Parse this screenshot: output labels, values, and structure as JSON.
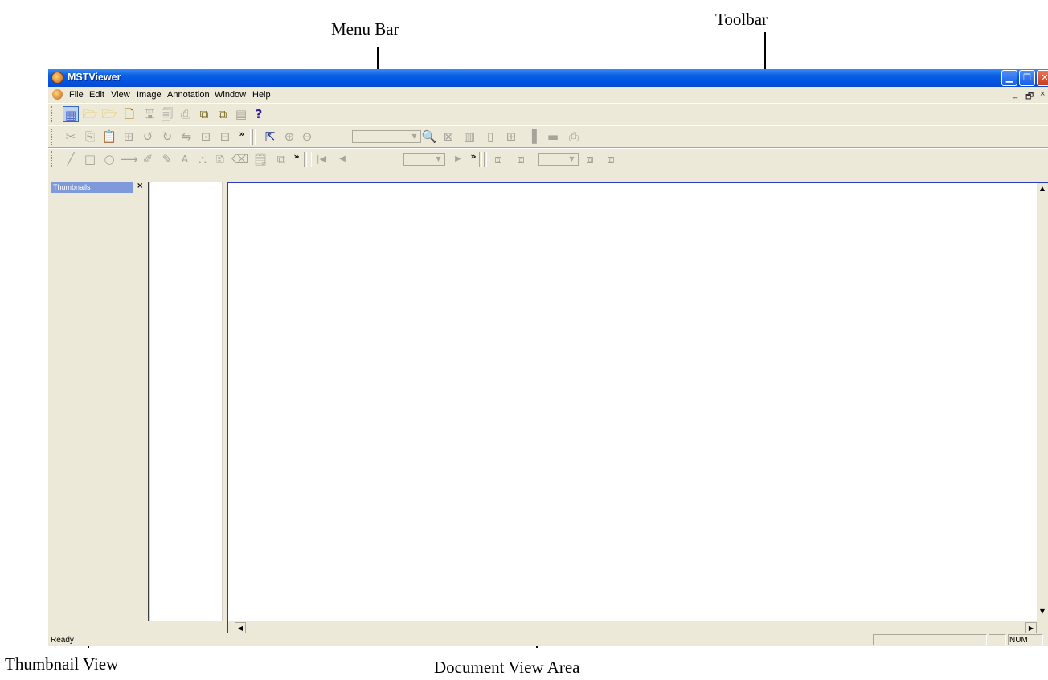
{
  "callouts": {
    "menu_bar": "Menu Bar",
    "toolbar": "Toolbar",
    "thumbnail_view": "Thumbnail View",
    "document_view_area": "Document View Area"
  },
  "window": {
    "title": "MSTViewer",
    "minimize_icon": "minimize-icon",
    "restore_icon": "restore-icon",
    "close_icon": "close-icon"
  },
  "menubar": {
    "items": [
      "File",
      "Edit",
      "View",
      "Image",
      "Annotation",
      "Window",
      "Help"
    ],
    "mdi_minimize": "_",
    "mdi_restore": "🗗",
    "mdi_close": "×"
  },
  "thumbnails": {
    "title": "Thumbnails",
    "close": "×"
  },
  "statusbar": {
    "ready": "Ready",
    "num": "NUM"
  },
  "colors": {
    "titlebar": "#0054e3",
    "chrome": "#ece9d8",
    "doc_border": "#2c39b8"
  }
}
